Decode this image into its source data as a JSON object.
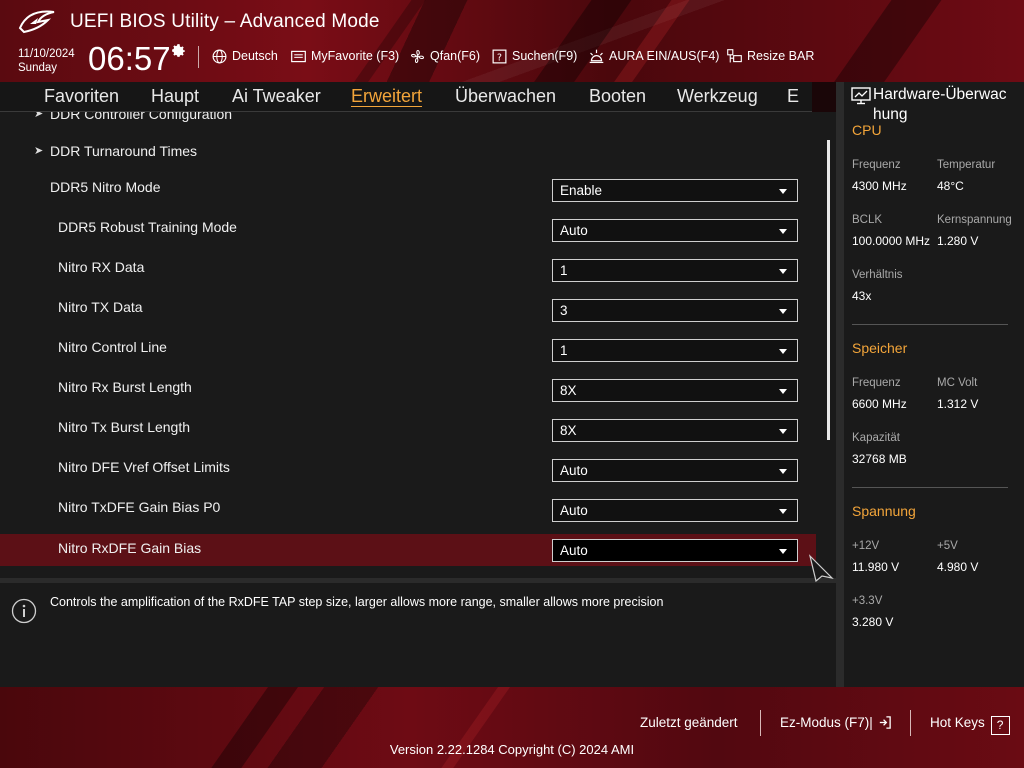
{
  "header": {
    "title": "UEFI BIOS Utility – Advanced Mode",
    "date": "11/10/2024",
    "weekday": "Sunday",
    "time": "06:57",
    "toolbar": [
      {
        "icon": "globe-icon",
        "label": "Deutsch"
      },
      {
        "icon": "myfavorite-icon",
        "label": "MyFavorite (F3)"
      },
      {
        "icon": "fan-icon",
        "label": "Qfan(F6)"
      },
      {
        "icon": "help-search-icon",
        "label": "Suchen(F9)"
      },
      {
        "icon": "aura-icon",
        "label": "AURA EIN/AUS(F4)"
      },
      {
        "icon": "resize-bar-icon",
        "label": "Resize BAR"
      }
    ]
  },
  "nav": {
    "tabs": [
      "Favoriten",
      "Haupt",
      "Ai Tweaker",
      "Erweitert",
      "Überwachen",
      "Booten",
      "Werkzeug",
      "E"
    ],
    "active": "Erweitert"
  },
  "main": {
    "items": [
      {
        "label": "DDR Controller Configuration",
        "submenu": true
      },
      {
        "label": "DDR Turnaround Times",
        "submenu": true
      },
      {
        "label": "DDR5 Nitro Mode",
        "value": "Enable"
      },
      {
        "label": "DDR5 Robust Training Mode",
        "value": "Auto"
      },
      {
        "label": "Nitro RX Data",
        "value": "1"
      },
      {
        "label": "Nitro TX Data",
        "value": "3"
      },
      {
        "label": "Nitro Control Line",
        "value": "1"
      },
      {
        "label": "Nitro Rx Burst Length",
        "value": "8X"
      },
      {
        "label": "Nitro Tx Burst Length",
        "value": "8X"
      },
      {
        "label": "Nitro DFE Vref Offset Limits",
        "value": "Auto"
      },
      {
        "label": "Nitro TxDFE Gain Bias P0",
        "value": "Auto"
      },
      {
        "label": "Nitro RxDFE Gain Bias",
        "value": "Auto",
        "selected": true
      }
    ]
  },
  "help": {
    "text": "Controls the amplification of the RxDFE TAP step size, larger allows more range, smaller allows more precision"
  },
  "hw_monitor": {
    "title": "Hardware-Überwachung",
    "title_line1": "Hardware-Überwac",
    "title_line2": "hung",
    "cpu": {
      "heading": "CPU",
      "freq_label": "Frequenz",
      "freq_value": "4300 MHz",
      "temp_label": "Temperatur",
      "temp_value": "48°C",
      "bclk_label": "BCLK",
      "bclk_value": "100.0000 MHz",
      "core_v_label": "Kernspannung",
      "core_v_value": "1.280 V",
      "ratio_label": "Verhältnis",
      "ratio_value": "43x"
    },
    "memory": {
      "heading": "Speicher",
      "freq_label": "Frequenz",
      "freq_value": "6600 MHz",
      "mcvolt_label": "MC Volt",
      "mcvolt_value": "1.312 V",
      "cap_label": "Kapazität",
      "cap_value": "32768 MB"
    },
    "voltage": {
      "heading": "Spannung",
      "v12_label": "+12V",
      "v12_value": "11.980 V",
      "v5_label": "+5V",
      "v5_value": "4.980 V",
      "v33_label": "+3.3V",
      "v33_value": "3.280 V"
    }
  },
  "footer": {
    "last_changed": "Zuletzt geändert",
    "ez_mode": "Ez-Modus (F7)|",
    "hot_keys": "Hot Keys",
    "hot_keys_key": "?",
    "version": "Version 2.22.1284 Copyright (C) 2024 AMI"
  },
  "colors": {
    "accent": "#f3a53a",
    "header_red": "#6e0b14",
    "selected_row": "#5c1016",
    "panel_bg": "#1a1a1a"
  }
}
